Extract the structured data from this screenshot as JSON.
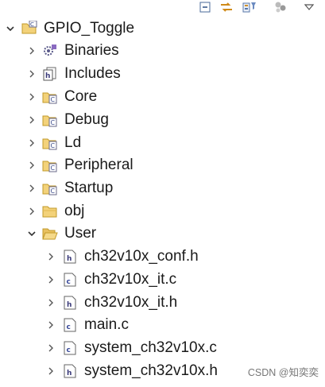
{
  "toolbar": {
    "buttons": [
      {
        "name": "collapse-all-icon"
      },
      {
        "name": "link-with-editor-icon"
      },
      {
        "name": "filter-icon"
      },
      {
        "name": "focus-task-icon"
      },
      {
        "name": "view-menu-icon"
      }
    ]
  },
  "tree": {
    "project": {
      "label": "GPIO_Toggle",
      "expanded": true,
      "icon": "project-icon"
    },
    "items": [
      {
        "label": "Binaries",
        "icon": "binaries-icon",
        "expanded": false
      },
      {
        "label": "Includes",
        "icon": "includes-icon",
        "expanded": false
      },
      {
        "label": "Core",
        "icon": "source-folder-icon",
        "expanded": false
      },
      {
        "label": "Debug",
        "icon": "source-folder-icon",
        "expanded": false
      },
      {
        "label": "Ld",
        "icon": "source-folder-icon",
        "expanded": false
      },
      {
        "label": "Peripheral",
        "icon": "source-folder-icon",
        "expanded": false
      },
      {
        "label": "Startup",
        "icon": "source-folder-icon",
        "expanded": false
      },
      {
        "label": "obj",
        "icon": "folder-icon",
        "expanded": false
      },
      {
        "label": "User",
        "icon": "folder-icon",
        "expanded": true
      }
    ],
    "user_files": [
      {
        "label": "ch32v10x_conf.h",
        "icon": "header-file-icon"
      },
      {
        "label": "ch32v10x_it.c",
        "icon": "c-file-icon"
      },
      {
        "label": "ch32v10x_it.h",
        "icon": "header-file-icon"
      },
      {
        "label": "main.c",
        "icon": "c-file-icon"
      },
      {
        "label": "system_ch32v10x.c",
        "icon": "c-file-icon"
      },
      {
        "label": "system_ch32v10x.h",
        "icon": "header-file-icon"
      }
    ]
  },
  "watermark": "CSDN @知奕奕"
}
